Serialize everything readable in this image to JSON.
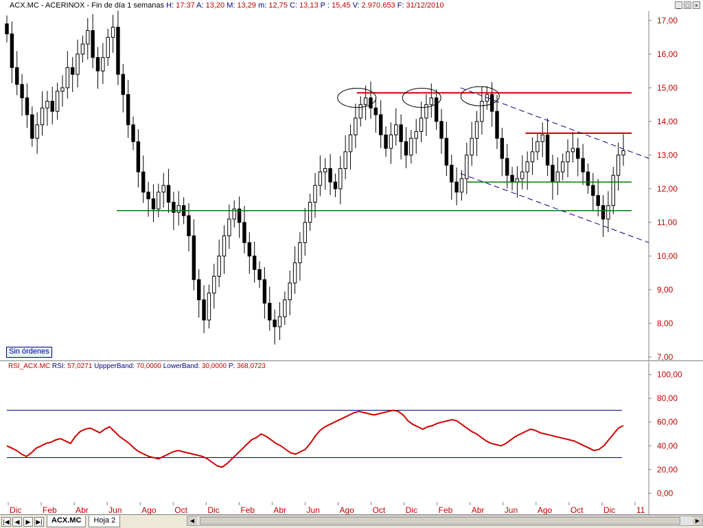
{
  "header": {
    "symbol": "ACX.MC",
    "name": "ACERINOX",
    "period": "Fin de día 1 semanas",
    "h_label": "H:",
    "h_value": "17:37",
    "a_label": "A:",
    "a_value": "13,20",
    "m_label": "M:",
    "m_value": "13,29",
    "mn_label": "m:",
    "mn_value": "12,75",
    "c_label": "C:",
    "c_value": "13,13",
    "p_label": "P :",
    "p_value": "15,45",
    "v_label": "V:",
    "v_value": "2.970.653",
    "f_label": "F:",
    "f_value": "31/12/2010",
    "window_buttons": [
      "_",
      "□",
      "×"
    ]
  },
  "order_badge": "Sin órdenes",
  "rsi_header": {
    "name": "RSI_ACX.MC",
    "rsi_label": "RSI:",
    "rsi_value": "57,0271",
    "upper_label": "UppperBand:",
    "upper_value": "70,0000",
    "lower_label": "LowerBand:",
    "lower_value": "30,0000",
    "p_label": "P:",
    "p_value": "368,0723"
  },
  "colors": {
    "axis_text": "#c00000",
    "resistance": "#d00000",
    "support": "#007a00",
    "channel": "#000080",
    "rsi_line": "#d00000",
    "rsi_bands": "#000080",
    "candle": "#000000"
  },
  "tabs": {
    "nav_buttons": [
      "|◀",
      "◀",
      "▶",
      "▶|"
    ],
    "sheets": [
      {
        "label": "ACX.MC",
        "active": true
      },
      {
        "label": "Hoja 2",
        "active": false
      }
    ]
  },
  "chart_data": [
    {
      "type": "candlestick",
      "title": "",
      "ylim": [
        7.0,
        17.2
      ],
      "y_ticks": [
        "17,00",
        "16,00",
        "15,00",
        "14,00",
        "13,00",
        "12,00",
        "11,00",
        "10,00",
        "9,00",
        "8,00",
        "7,00"
      ],
      "x_tick_labels": [
        "Dic",
        "Feb",
        "Abr",
        "Jun",
        "Ago",
        "Oct",
        "Dic",
        "Feb",
        "Abr",
        "Jun",
        "Ago",
        "Oct",
        "Dic",
        "Feb",
        "Abr",
        "Jun",
        "Ago",
        "Oct",
        "Dic",
        "11"
      ],
      "closes": [
        16.6,
        15.6,
        15.1,
        14.7,
        14.2,
        13.5,
        13.9,
        14.4,
        14.6,
        14.3,
        14.9,
        15.0,
        15.6,
        15.4,
        16.0,
        16.3,
        16.7,
        15.9,
        15.5,
        15.9,
        16.5,
        16.8,
        15.4,
        14.8,
        13.9,
        13.4,
        12.5,
        11.9,
        11.7,
        11.4,
        11.9,
        12.1,
        11.6,
        11.3,
        11.5,
        11.2,
        10.6,
        9.3,
        8.7,
        8.1,
        8.9,
        9.4,
        10.0,
        10.6,
        11.1,
        11.4,
        11.0,
        10.4,
        10.0,
        9.6,
        9.3,
        8.6,
        8.1,
        7.9,
        8.2,
        8.7,
        9.2,
        9.8,
        10.4,
        11.0,
        11.6,
        12.1,
        12.5,
        12.6,
        12.2,
        12.0,
        12.6,
        13.1,
        13.6,
        14.1,
        14.5,
        14.7,
        14.4,
        14.2,
        13.6,
        13.2,
        13.6,
        13.9,
        13.4,
        13.0,
        13.5,
        13.7,
        14.1,
        14.5,
        14.7,
        14.0,
        13.5,
        12.7,
        12.2,
        11.9,
        12.3,
        13.0,
        13.5,
        14.0,
        14.6,
        14.8,
        14.3,
        13.5,
        12.9,
        12.4,
        12.2,
        12.3,
        12.5,
        12.8,
        13.1,
        13.4,
        13.6,
        12.7,
        12.2,
        12.5,
        12.8,
        13.1,
        13.2,
        12.9,
        12.5,
        12.1,
        11.8,
        11.5,
        11.1,
        11.5,
        12.4,
        13.0,
        13.13
      ],
      "lines": [
        {
          "kind": "resistance",
          "value": 14.85,
          "x_from": 0.55,
          "x_to": 1.0
        },
        {
          "kind": "resistance",
          "value": 13.65,
          "x_from": 0.81,
          "x_to": 1.0
        },
        {
          "kind": "support",
          "value": 11.35,
          "x_from": 0.18,
          "x_to": 1.0
        },
        {
          "kind": "support",
          "value": 12.2,
          "x_from": 0.72,
          "x_to": 1.0
        },
        {
          "kind": "channel",
          "from": [
            0.71,
            15.0
          ],
          "to": [
            1.0,
            12.9
          ]
        },
        {
          "kind": "channel",
          "from": [
            0.71,
            12.45
          ],
          "to": [
            1.0,
            10.4
          ]
        }
      ],
      "ellipses": [
        {
          "x": 0.55,
          "y": 14.7
        },
        {
          "x": 0.65,
          "y": 14.7
        },
        {
          "x": 0.74,
          "y": 14.75
        }
      ]
    },
    {
      "type": "line",
      "title": "",
      "ylim": [
        -5,
        105
      ],
      "y_ticks": [
        "100,00",
        "80,00",
        "60,00",
        "40,00",
        "20,00",
        "0,00"
      ],
      "bands": [
        70,
        30
      ],
      "series": [
        {
          "values": [
            40,
            38,
            36,
            33,
            31,
            34,
            38,
            40,
            42,
            43,
            45,
            46,
            44,
            42,
            48,
            52,
            54,
            55,
            53,
            51,
            54,
            56,
            52,
            48,
            45,
            42,
            38,
            35,
            33,
            31,
            30,
            29,
            31,
            33,
            35,
            36,
            35,
            34,
            33,
            32,
            31,
            29,
            26,
            23,
            22,
            25,
            29,
            33,
            37,
            41,
            45,
            47,
            50,
            48,
            45,
            42,
            40,
            37,
            34,
            33,
            35,
            37,
            42,
            48,
            53,
            56,
            58,
            60,
            62,
            64,
            66,
            68,
            69,
            68,
            67,
            66,
            67,
            68,
            69,
            70,
            69,
            66,
            61,
            58,
            56,
            54,
            56,
            57,
            59,
            60,
            61,
            62,
            61,
            58,
            55,
            52,
            50,
            47,
            44,
            42,
            41,
            40,
            42,
            45,
            48,
            50,
            52,
            54,
            53,
            51,
            50,
            49,
            48,
            47,
            46,
            45,
            44,
            42,
            40,
            38,
            36,
            37,
            40,
            45,
            50,
            55,
            57
          ]
        }
      ]
    }
  ]
}
